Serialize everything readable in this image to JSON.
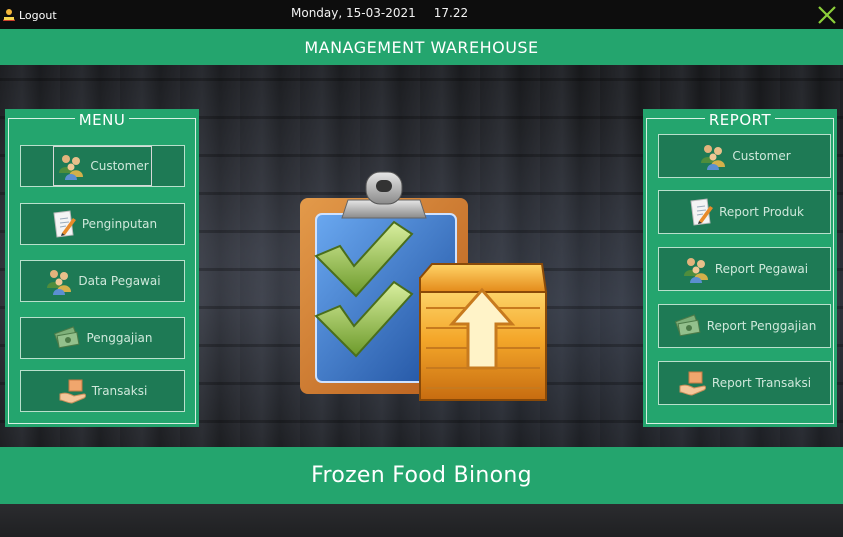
{
  "topbar": {
    "logout_label": "Logout",
    "date": "Monday, 15-03-2021",
    "time": "17.22"
  },
  "header": {
    "title": "MANAGEMENT WAREHOUSE"
  },
  "menu": {
    "title": "MENU",
    "items": [
      {
        "label": "Customer",
        "icon": "users-icon"
      },
      {
        "label": "Penginputan",
        "icon": "document-pencil-icon"
      },
      {
        "label": "Data Pegawai",
        "icon": "users-icon"
      },
      {
        "label": "Penggajian",
        "icon": "money-icon"
      },
      {
        "label": "Transaksi",
        "icon": "hand-box-icon"
      }
    ]
  },
  "report": {
    "title": "REPORT",
    "items": [
      {
        "label": "Customer",
        "icon": "users-icon"
      },
      {
        "label": "Report Produk",
        "icon": "document-pencil-icon"
      },
      {
        "label": "Report Pegawai",
        "icon": "users-icon"
      },
      {
        "label": "Report Penggajian",
        "icon": "money-icon"
      },
      {
        "label": "Report Transaksi",
        "icon": "hand-box-icon"
      }
    ]
  },
  "footer": {
    "title": "Frozen Food Binong"
  },
  "colors": {
    "accent": "#24a56e",
    "button": "#1e7a55",
    "topbar": "#0d0d0d",
    "close": "#8ccf3a"
  },
  "center_icon": "clipboard-checklist-box-icon"
}
